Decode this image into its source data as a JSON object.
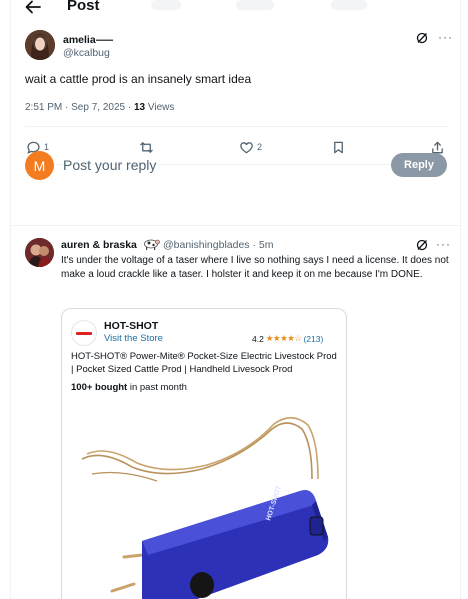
{
  "header": {
    "title": "Post",
    "back_icon": "arrow-left-icon"
  },
  "post": {
    "author_name": "amelia⸺",
    "author_handle": "@kcalbug",
    "text": "wait a cattle prod is an insanely smart idea",
    "time": "2:51 PM · Sep 7, 2025 · ",
    "views_count": "13",
    "views_label": " Views",
    "actions": {
      "replies": "1",
      "reposts": "",
      "likes": "2"
    }
  },
  "composer": {
    "avatar_letter": "M",
    "avatar_color": "#f47c20",
    "placeholder": "Post your reply",
    "button_label": "Reply"
  },
  "reply": {
    "author_name": "auren & braska",
    "author_handle": "@banishingblades · 5m",
    "text": "It's under the voltage of a taser where I live so nothing says I need a license. It does not make a loud crackle like a taser. I holster it and keep it on me because I'm DONE."
  },
  "product_card": {
    "brand": "HOT-SHOT",
    "store_link": "Visit the Store",
    "rating": "4.2",
    "stars": "★★★★☆",
    "rating_count": "(213)",
    "title": "HOT-SHOT® Power-Mite® Pocket-Size Electric Livestock Prod | Pocket Sized Cattle Prod | Handheld Livesock Prod",
    "bought_bold": "100+ bought",
    "bought_rest": " in past month",
    "device_label": "HOT-SHOT"
  },
  "colors": {
    "accent": "#1d9bf0",
    "muted": "#536471",
    "reply_button": "#8b98a5",
    "product_blue": "#2d31b8",
    "star": "#e78b17"
  }
}
